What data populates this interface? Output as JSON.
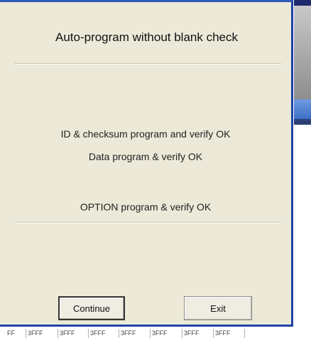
{
  "dialog": {
    "title": "Auto-program without blank check",
    "messages": [
      "ID & checksum program and verify OK",
      "Data program & verify OK",
      "OPTION program & verify OK"
    ],
    "buttons": {
      "continue_label": "Continue",
      "exit_label": "Exit"
    }
  },
  "status_bar": {
    "cells": [
      "FF",
      "3FFF",
      "3FFF",
      "3FFF",
      "3FFF",
      "3FFF",
      "3FFF",
      "3FFF"
    ]
  },
  "colors": {
    "dialog_background": "#ece9d8",
    "frame_blue": "#2f57b7"
  }
}
